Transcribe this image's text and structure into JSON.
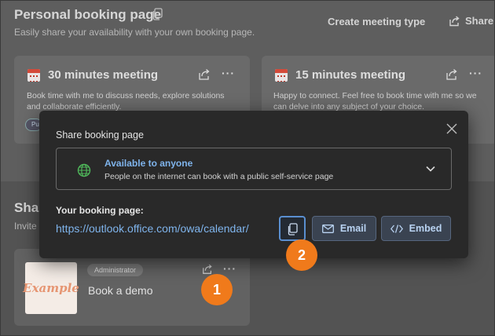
{
  "page": {
    "title": "Personal booking page",
    "subtitle": "Easily share your availability with your own booking page.",
    "create_label": "Create meeting type",
    "share_label": "Share"
  },
  "cards": [
    {
      "title": "30 minutes meeting",
      "description": "Book time with me to discuss needs, explore solutions and collaborate efficiently.",
      "pill": "Pu"
    },
    {
      "title": "15 minutes meeting",
      "description": "Happy to connect. Feel free to book time with me so we can delve into any subject of your choice."
    }
  ],
  "section": {
    "title": "Shar",
    "subtitle": "Invite"
  },
  "demo_card": {
    "logo_text": "Example",
    "badge": "Administrator",
    "title": "Book a demo"
  },
  "dialog": {
    "title": "Share booking page",
    "availability": {
      "title": "Available to anyone",
      "subtitle": "People on the internet can book with a public self-service page"
    },
    "link_label": "Your booking page:",
    "link_url": "https://outlook.office.com/owa/calendar/",
    "email_label": "Email",
    "embed_label": "Embed"
  },
  "steps": [
    "1",
    "2"
  ],
  "colors": {
    "accent": "#7fb4ec",
    "step": "#f07a1b"
  }
}
